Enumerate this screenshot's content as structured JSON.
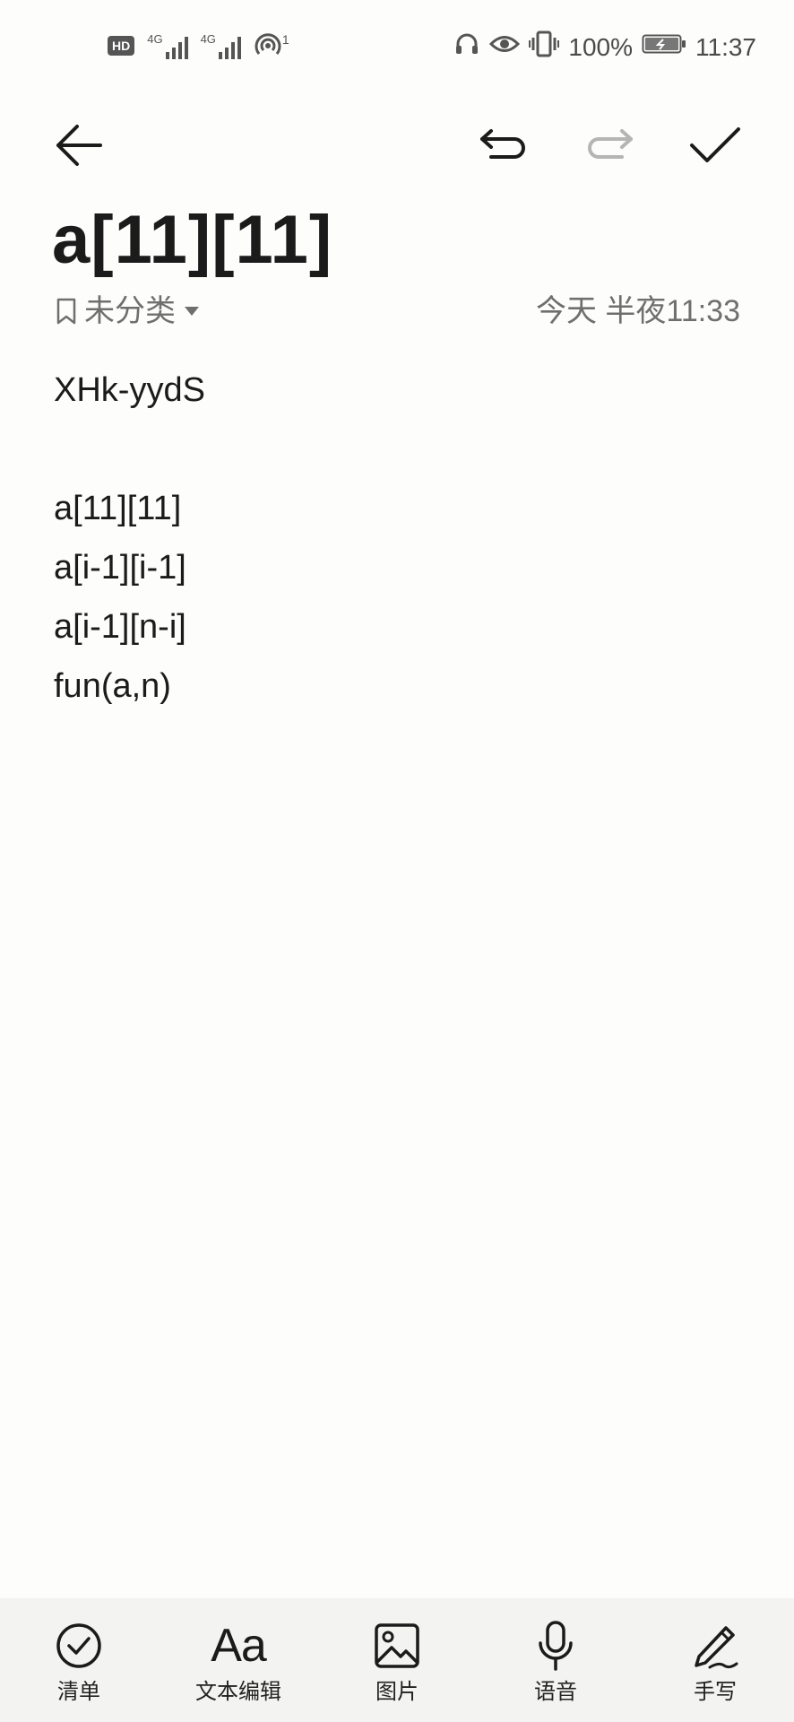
{
  "status_bar": {
    "hd_label": "HD",
    "sim1_label": "4G",
    "sim2_label": "4G",
    "hotspot_count": "1",
    "battery_percent": "100%",
    "time": "11:37",
    "icons": [
      "hd-icon",
      "signal-icon",
      "signal-icon",
      "hotspot-icon",
      "headphones-icon",
      "eye-icon",
      "vibrate-icon",
      "battery-icon"
    ]
  },
  "toolbar": {
    "icons": [
      "back-arrow-icon",
      "undo-icon",
      "redo-icon",
      "checkmark-icon"
    ]
  },
  "note": {
    "title": "a[11][11]",
    "category": "未分类",
    "timestamp": "今天 半夜11:33",
    "lines": [
      "XHk-yydS",
      "",
      "a[11][11]",
      "a[i-1][i-1]",
      "a[i-1][n-i]",
      "fun(a,n)"
    ]
  },
  "bottom_toolbar": {
    "items": [
      {
        "label": "清单",
        "icon": "checklist-icon"
      },
      {
        "label": "文本编辑",
        "icon": "text-format-icon",
        "glyph": "Aa"
      },
      {
        "label": "图片",
        "icon": "image-icon"
      },
      {
        "label": "语音",
        "icon": "microphone-icon"
      },
      {
        "label": "手写",
        "icon": "pen-icon"
      }
    ]
  },
  "colors": {
    "background": "#fdfdfb",
    "text": "#1b1b1b",
    "secondary_text": "#6f6f6f",
    "disabled_icon": "#b5b5b5",
    "bottom_bar": "#f3f3f2"
  }
}
